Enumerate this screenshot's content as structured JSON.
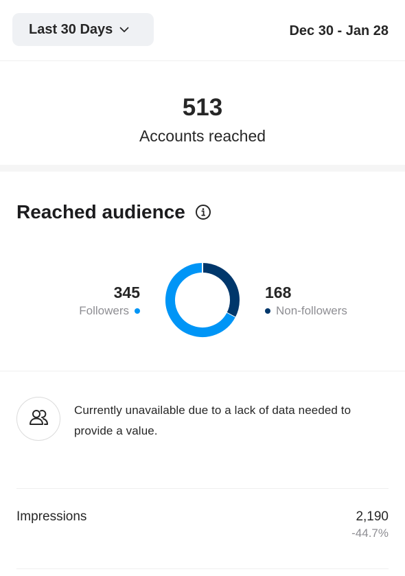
{
  "header": {
    "period_label": "Last 30 Days",
    "date_range": "Dec 30 - Jan 28"
  },
  "reach": {
    "value": "513",
    "label": "Accounts reached"
  },
  "audience": {
    "title": "Reached audience",
    "followers": {
      "value": "345",
      "label": "Followers",
      "color": "#0095f6"
    },
    "non_followers": {
      "value": "168",
      "label": "Non-followers",
      "color": "#00376b"
    }
  },
  "notice": {
    "text": "Currently unavailable due to a lack of data needed to provide a value.",
    "icon": "people-icon"
  },
  "impressions": {
    "label": "Impressions",
    "value": "2,190",
    "delta": "-44.7%"
  },
  "icons": {
    "period_chevron": "chevron-down-icon",
    "info": "info-icon"
  },
  "chart_data": {
    "type": "pie",
    "categories": [
      "Followers",
      "Non-followers"
    ],
    "values": [
      345,
      168
    ],
    "colors": [
      "#0095f6",
      "#00376b"
    ],
    "title": "Reached audience"
  }
}
